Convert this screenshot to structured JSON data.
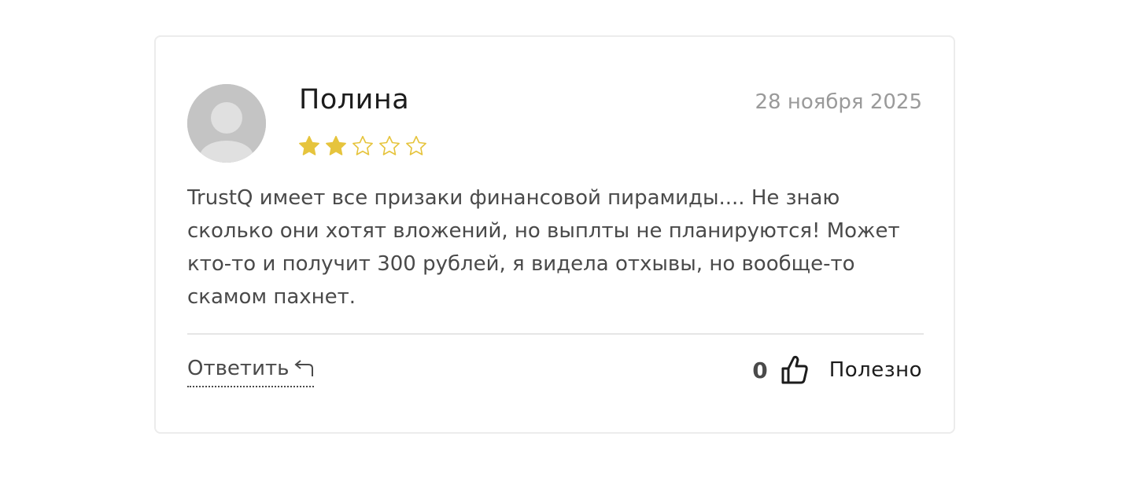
{
  "review": {
    "author": "Полина",
    "date": "28 ноября 2025",
    "rating": 2,
    "max_rating": 5,
    "star_color": "#e6c43d",
    "text": "TrustQ имеет все призаки финансовой пирамиды.... Не знаю сколько они хотят вложений, но выплты не планируются! Может кто-то и получит 300 рублей, я видела отхывы, но вообще-то скамом пахнет.",
    "avatar_icon": "user-avatar-placeholder"
  },
  "actions": {
    "reply_label": "Ответить",
    "reply_icon": "reply-arrow-icon",
    "helpful_count": "0",
    "helpful_icon": "thumbs-up-icon",
    "helpful_label": "Полезно"
  }
}
